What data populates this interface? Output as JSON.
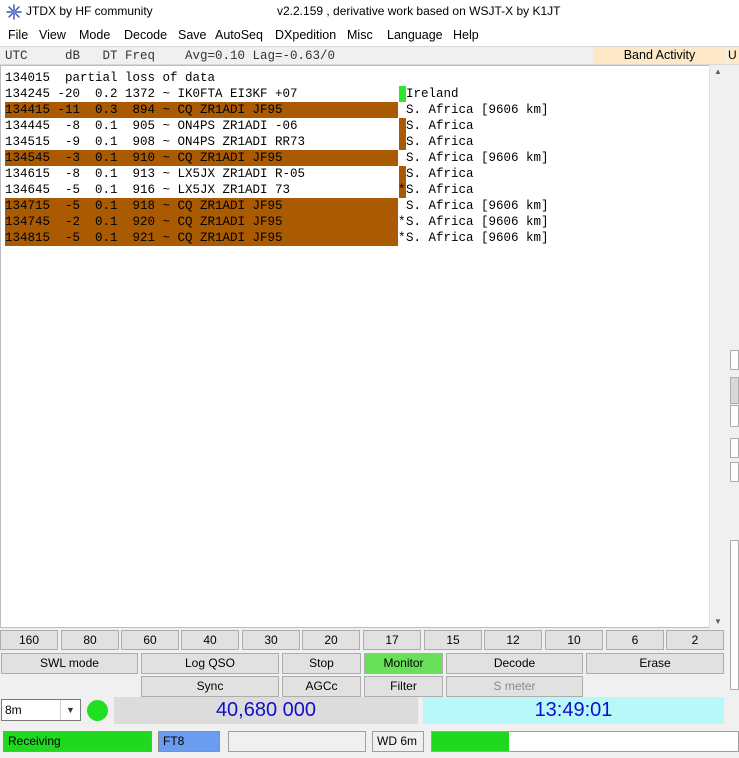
{
  "titlebar": {
    "app_title": "JTDX  by HF community",
    "version_title": "v2.2.159 , derivative work based on WSJT-X by K1JT"
  },
  "menu": [
    "File",
    "View",
    "Mode",
    "Decode",
    "Save",
    "AutoSeq",
    "DXpedition",
    "Misc",
    "Language",
    "Help"
  ],
  "header": {
    "columns": "UTC     dB   DT Freq    Avg=0.10 Lag=-0.63/0",
    "band_activity": "Band Activity",
    "band_activity_2": "U"
  },
  "decodes": [
    {
      "text": "134015  partial loss of data",
      "highlight": false,
      "mark": "",
      "country": "",
      "star": ""
    },
    {
      "text": "134245 -20  0.2 1372 ~ IK0FTA EI3KF +07",
      "highlight": false,
      "mark": "#2ee62e",
      "country": "Ireland",
      "star": ""
    },
    {
      "text": "134415 -11  0.3  894 ~ CQ ZR1ADI JF95",
      "highlight": true,
      "mark": "",
      "country": "S. Africa [9606 km]",
      "star": ""
    },
    {
      "text": "134445  -8  0.1  905 ~ ON4PS ZR1ADI -06",
      "highlight": false,
      "mark": "#aa5a00",
      "country": "S. Africa",
      "star": ""
    },
    {
      "text": "134515  -9  0.1  908 ~ ON4PS ZR1ADI RR73",
      "highlight": false,
      "mark": "#aa5a00",
      "country": "S. Africa",
      "star": ""
    },
    {
      "text": "134545  -3  0.1  910 ~ CQ ZR1ADI JF95",
      "highlight": true,
      "mark": "",
      "country": "S. Africa [9606 km]",
      "star": ""
    },
    {
      "text": "134615  -8  0.1  913 ~ LX5JX ZR1ADI R-05",
      "highlight": false,
      "mark": "#aa5a00",
      "country": "S. Africa",
      "star": ""
    },
    {
      "text": "134645  -5  0.1  916 ~ LX5JX ZR1ADI 73",
      "highlight": false,
      "mark": "#aa5a00",
      "country": "S. Africa",
      "star": "*"
    },
    {
      "text": "134715  -5  0.1  918 ~ CQ ZR1ADI JF95",
      "highlight": true,
      "mark": "",
      "country": "S. Africa [9606 km]",
      "star": ""
    },
    {
      "text": "134745  -2  0.1  920 ~ CQ ZR1ADI JF95",
      "highlight": true,
      "mark": "",
      "country": "S. Africa [9606 km]",
      "star": "*"
    },
    {
      "text": "134815  -5  0.1  921 ~ CQ ZR1ADI JF95",
      "highlight": true,
      "mark": "",
      "country": "S. Africa [9606 km]",
      "star": "*"
    }
  ],
  "band_buttons": [
    "160",
    "80",
    "60",
    "40",
    "30",
    "20",
    "17",
    "15",
    "12",
    "10",
    "6",
    "2"
  ],
  "controls": {
    "swl_mode": "SWL mode",
    "log_qso": "Log QSO",
    "stop": "Stop",
    "monitor": "Monitor",
    "decode": "Decode",
    "erase": "Erase",
    "sync": "Sync",
    "agcc": "AGCc",
    "filter": "Filter",
    "s_meter": "S meter"
  },
  "band_select": {
    "value": "8m"
  },
  "frequency": "40,680 000",
  "clock": "13:49:01",
  "status": {
    "receiving": "Receiving",
    "mode": "FT8",
    "wd": "WD 6m",
    "progress_fraction": 0.25
  },
  "colors": {
    "highlight": "#aa5a00",
    "led": "#1ee01e",
    "monitor_on": "#69e05a"
  }
}
